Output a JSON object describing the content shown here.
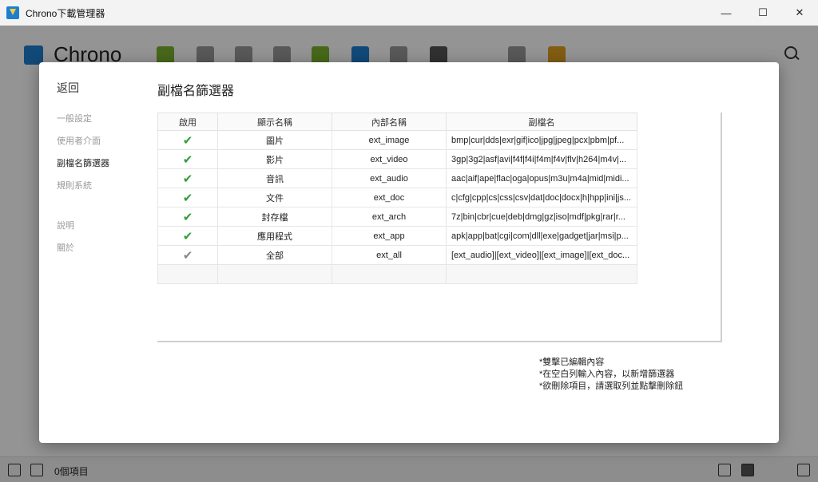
{
  "window": {
    "title": "Chrono下載管理器",
    "controls": [
      "—",
      "☐",
      "✕"
    ]
  },
  "app": {
    "logo_text": "Chrono",
    "status_text": "0個項目"
  },
  "modal": {
    "back_label": "返回",
    "nav": [
      {
        "label": "一般設定"
      },
      {
        "label": "使用者介面"
      },
      {
        "label": "副檔名篩選器"
      },
      {
        "label": "規則系統"
      },
      {
        "label": "說明"
      },
      {
        "label": "關於"
      }
    ],
    "section_title": "副檔名篩選器",
    "columns": [
      "啟用",
      "顯示名稱",
      "內部名稱",
      "副檔名"
    ],
    "rows": [
      {
        "enabled": "✔",
        "display": "圖片",
        "internal": "ext_image",
        "extensions": "bmp|cur|dds|exr|gif|ico|jpg|jpeg|pcx|pbm|pf..."
      },
      {
        "enabled": "✔",
        "display": "影片",
        "internal": "ext_video",
        "extensions": "3gp|3g2|asf|avi|f4f|f4i|f4m|f4v|flv|h264|m4v|..."
      },
      {
        "enabled": "✔",
        "display": "音訊",
        "internal": "ext_audio",
        "extensions": "aac|aif|ape|flac|oga|opus|m3u|m4a|mid|midi..."
      },
      {
        "enabled": "✔",
        "display": "文件",
        "internal": "ext_doc",
        "extensions": "c|cfg|cpp|cs|css|csv|dat|doc|docx|h|hpp|ini|js..."
      },
      {
        "enabled": "✔",
        "display": "封存檔",
        "internal": "ext_arch",
        "extensions": "7z|bin|cbr|cue|deb|dmg|gz|iso|mdf|pkg|rar|r..."
      },
      {
        "enabled": "✔",
        "display": "應用程式",
        "internal": "ext_app",
        "extensions": "apk|app|bat|cgi|com|dll|exe|gadget|jar|msi|p..."
      },
      {
        "enabled": "✔",
        "display": "全部",
        "internal": "ext_all",
        "extensions": "[ext_audio]|[ext_video]|[ext_image]|[ext_doc..."
      }
    ],
    "notes": [
      "*雙擊已編輯內容",
      "*在空白列輸入內容，以新增篩選器",
      "*欲刪除項目，請選取列並點擊刪除鈕"
    ]
  },
  "colors": {
    "check_green": "#2e9e3a",
    "check_gray": "#888888",
    "overlay": "rgba(0,0,0,0.42)"
  }
}
